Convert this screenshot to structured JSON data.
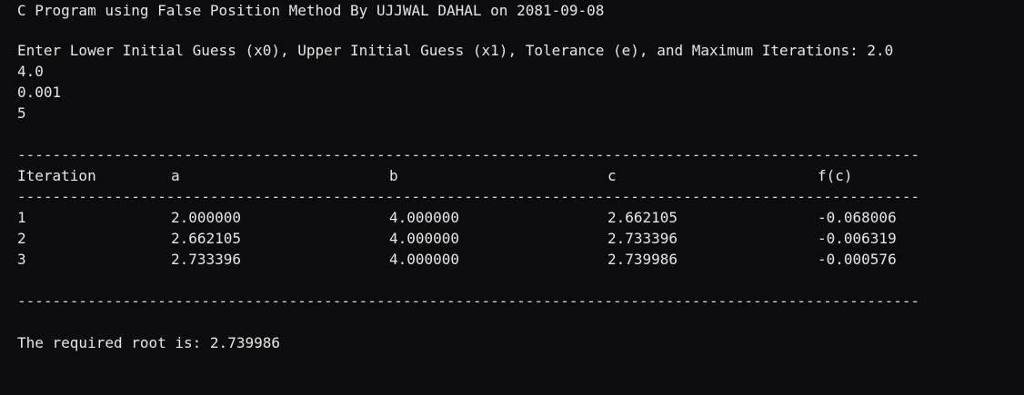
{
  "header": "C Program using False Position Method By UJJWAL DAHAL on 2081-09-08",
  "prompt": "Enter Lower Initial Guess (x0), Upper Initial Guess (x1), Tolerance (e), and Maximum Iterations: 2.0",
  "inputs": [
    "4.0",
    "0.001",
    "5"
  ],
  "separator": "---------------------------------------------------------------------------------------------------------",
  "table": {
    "headers": [
      "Iteration",
      "a",
      "b",
      "c",
      "f(c)"
    ],
    "rows": [
      [
        "1",
        "2.000000",
        "4.000000",
        "2.662105",
        "-0.068006"
      ],
      [
        "2",
        "2.662105",
        "4.000000",
        "2.733396",
        "-0.006319"
      ],
      [
        "3",
        "2.733396",
        "4.000000",
        "2.739986",
        "-0.000576"
      ]
    ]
  },
  "result": "The required root is: 2.739986",
  "colors": {
    "background": "#0c0c0f",
    "text": "#e6e6e6"
  }
}
